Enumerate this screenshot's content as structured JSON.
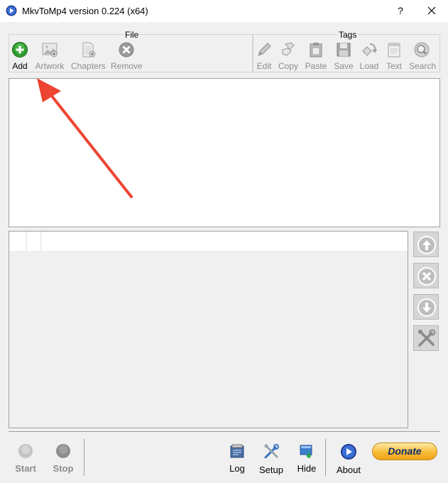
{
  "window": {
    "title": "MkvToMp4 version 0.224 (x64)",
    "help_glyph": "?"
  },
  "toolbar": {
    "file_group_label": "File",
    "tags_group_label": "Tags",
    "file_buttons": [
      {
        "label": "Add",
        "icon": "add-icon",
        "enabled": true
      },
      {
        "label": "Artwork",
        "icon": "artwork-icon",
        "enabled": false
      },
      {
        "label": "Chapters",
        "icon": "chapters-icon",
        "enabled": false
      },
      {
        "label": "Remove",
        "icon": "remove-icon",
        "enabled": false
      }
    ],
    "tag_buttons": [
      {
        "label": "Edit",
        "icon": "pencil-icon",
        "enabled": false
      },
      {
        "label": "Copy",
        "icon": "copy-icon",
        "enabled": false
      },
      {
        "label": "Paste",
        "icon": "paste-icon",
        "enabled": false
      },
      {
        "label": "Save",
        "icon": "floppy-icon",
        "enabled": false
      },
      {
        "label": "Load",
        "icon": "load-icon",
        "enabled": false
      },
      {
        "label": "Text",
        "icon": "text-icon",
        "enabled": false
      },
      {
        "label": "Search",
        "icon": "search-icon",
        "enabled": false
      }
    ]
  },
  "side_buttons": [
    {
      "icon": "arrow-up-icon"
    },
    {
      "icon": "remove-track-icon"
    },
    {
      "icon": "arrow-down-icon"
    },
    {
      "icon": "tools-icon"
    }
  ],
  "bottom_bar": {
    "start_label": "Start",
    "stop_label": "Stop",
    "log_label": "Log",
    "setup_label": "Setup",
    "hide_label": "Hide",
    "about_label": "About",
    "donate_label": "Donate"
  },
  "colors": {
    "annotation_arrow": "#ee4433",
    "add_green": "#2e9b2e",
    "donate_gold": "#f7b830"
  }
}
